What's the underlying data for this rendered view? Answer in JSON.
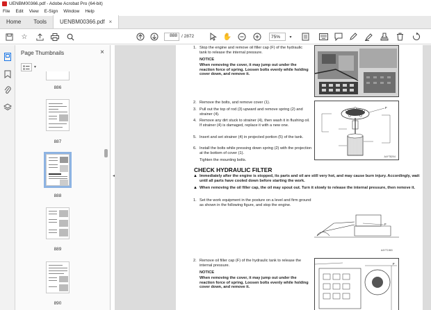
{
  "window": {
    "title": "UENBM00366.pdf - Adobe Acrobat Pro (64-bit)"
  },
  "menu": [
    "File",
    "Edit",
    "View",
    "E-Sign",
    "Window",
    "Help"
  ],
  "tabs": {
    "home": "Home",
    "tools": "Tools",
    "doc": "UENBM00366.pdf"
  },
  "toolbar": {
    "page_current": "888",
    "page_total": "/ 2872",
    "zoom": "75%"
  },
  "thumbnails": {
    "header": "Page Thumbnails",
    "pages": [
      "886",
      "887",
      "888",
      "889",
      "890"
    ],
    "active": "888"
  },
  "page": {
    "step1": "Stop the engine and remove oil filler cap (F) of the hydraulic tank to release the internal pressure.",
    "notice1_title": "NOTICE",
    "notice1_text": "When removing the cover, it may jump out under the reaction force of spring. Loosen bolts evenly while holding cover down, and remove it.",
    "step2": "Remove the bolts, and remove cover (1).",
    "step3": "Pull out the top of rod (3) upward and remove spring (2) and strainer (4).",
    "step4": "Remove any dirt stuck to strainer (4), then wash it in flushing oil. If strainer (4) is damaged, replace it with a new one.",
    "step5": "Insert and set strainer (4) in projected portion (5) of the tank.",
    "step6": "Install the bolts while pressing down spring (2) with the projection at the bottom of cover (1).",
    "step6b": "Tighten the mounting bolts.",
    "heading": "CHECK HYDRAULIC FILTER",
    "warn1": "Immediately after the engine is stopped, its parts and oil are still very hot, and may cause burn injury. Accordingly, wait until all parts have cooled down before starting the work.",
    "warn2": "When removing the oil filler cap, the oil may spout out. Turn it slowly to release the internal pressure, then remove it.",
    "bstep1": "Set the work equipment in the posture on a level and firm ground as shown in the following figure, and stop the engine.",
    "bstep2": "Remove oil filler cap (F) of the hydraulic tank to release the internal pressure.",
    "notice2_title": "NOTICE",
    "notice2_text": "When removing the cover, it may jump out under the reaction force of spring. Loosen bolts evenly while holding cover down, and remove it.",
    "fig_code_1": "A4YT8204",
    "fig_code_2": "A4YT1963"
  }
}
